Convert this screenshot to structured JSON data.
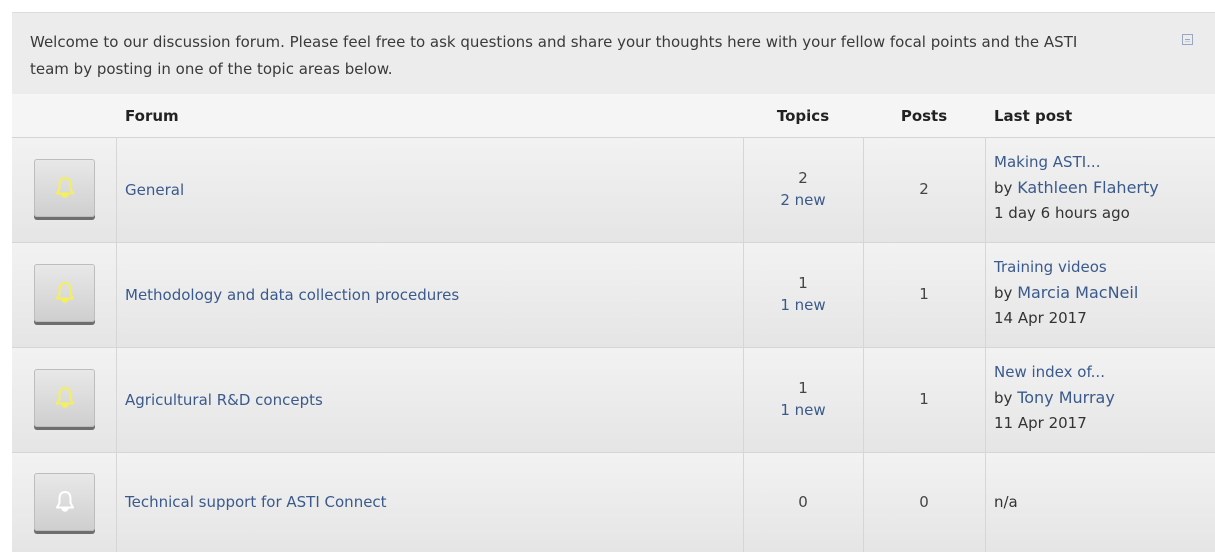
{
  "intro": {
    "text": "Welcome to our discussion forum. Please feel free to ask questions and share your thoughts here with your fellow focal points and the ASTI team by posting in one of the topic areas below."
  },
  "header": {
    "forum": "Forum",
    "topics": "Topics",
    "posts": "Posts",
    "last_post": "Last post"
  },
  "colors": {
    "link": "#3a5a8c",
    "bell_active": "#f5f05a",
    "bell_inactive": "#ffffff"
  },
  "forums": [
    {
      "name": "General",
      "icon": "bell-icon",
      "has_new": true,
      "topics": "2",
      "topics_new": "2 new",
      "posts": "2",
      "last_title": "Making ASTI...",
      "last_by": "by",
      "last_author": "Kathleen Flaherty",
      "last_when": "1 day 6 hours ago"
    },
    {
      "name": "Methodology and data collection procedures",
      "icon": "bell-icon",
      "has_new": true,
      "topics": "1",
      "topics_new": "1 new",
      "posts": "1",
      "last_title": "Training videos",
      "last_by": "by",
      "last_author": "Marcia MacNeil",
      "last_when": "14 Apr 2017"
    },
    {
      "name": "Agricultural R&D concepts",
      "icon": "bell-icon",
      "has_new": true,
      "topics": "1",
      "topics_new": "1 new",
      "posts": "1",
      "last_title": "New index of...",
      "last_by": "by",
      "last_author": "Tony Murray",
      "last_when": "11 Apr 2017"
    },
    {
      "name": "Technical support for ASTI Connect",
      "icon": "bell-icon",
      "has_new": false,
      "topics": "0",
      "posts": "0",
      "last_na": "n/a"
    }
  ]
}
